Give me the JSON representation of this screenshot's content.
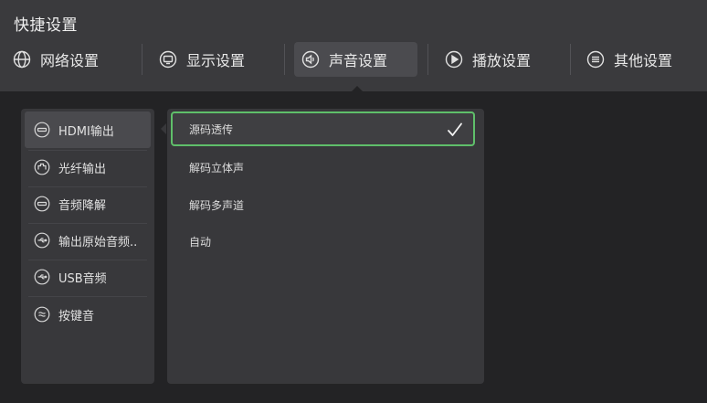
{
  "header": {
    "title": "快捷设置"
  },
  "tabs": [
    {
      "label": "网络设置",
      "icon": "globe-icon"
    },
    {
      "label": "显示设置",
      "icon": "monitor-icon"
    },
    {
      "label": "声音设置",
      "icon": "speaker-icon"
    },
    {
      "label": "播放设置",
      "icon": "play-icon"
    },
    {
      "label": "其他设置",
      "icon": "menu-icon"
    }
  ],
  "active_tab": "声音设置",
  "sidebar": {
    "items": [
      {
        "label": "HDMI输出",
        "icon": "hdmi-icon"
      },
      {
        "label": "光纤输出",
        "icon": "optical-icon"
      },
      {
        "label": "音频降解",
        "icon": "hdmi-icon"
      },
      {
        "label": "输出原始音频..",
        "icon": "usb-icon"
      },
      {
        "label": "USB音频",
        "icon": "usb-icon"
      },
      {
        "label": "按键音",
        "icon": "waves-icon"
      }
    ],
    "active_item": "HDMI输出"
  },
  "options": {
    "items": [
      {
        "label": "源码透传"
      },
      {
        "label": "解码立体声"
      },
      {
        "label": "解码多声道"
      },
      {
        "label": "自动"
      }
    ],
    "selected": "源码透传"
  },
  "colors": {
    "background": "#232325",
    "header": "#3a3a3d",
    "panel": "#38383b",
    "accent_green": "#5fbf6a"
  }
}
